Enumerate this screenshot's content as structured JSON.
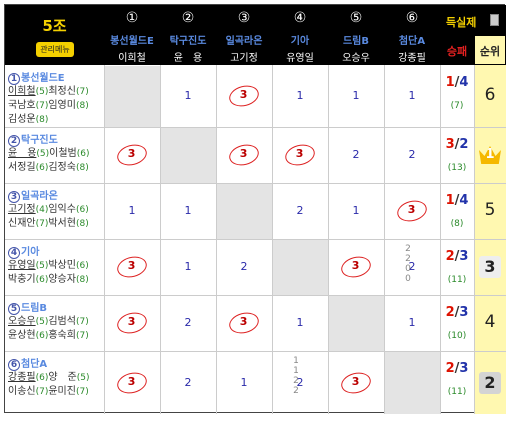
{
  "header": {
    "group_title": "5조",
    "admin_button": "관리메뉴",
    "scorer_label": "득실제",
    "win_loss_label": "승패",
    "rank_label": "순위"
  },
  "teams": [
    {
      "num": "①",
      "name": "봉선월드E",
      "captain": "이희철",
      "name_color": "#5a8ae0"
    },
    {
      "num": "②",
      "name": "탁구진도",
      "captain": "윤　용",
      "name_color": "#5a8ae0"
    },
    {
      "num": "③",
      "name": "일곡라온",
      "captain": "고기정",
      "name_color": "#5a8ae0"
    },
    {
      "num": "④",
      "name": "기아",
      "captain": "유영일",
      "name_color": "#5a8ae0"
    },
    {
      "num": "⑤",
      "name": "드림B",
      "captain": "오승우",
      "name_color": "#5a8ae0"
    },
    {
      "num": "⑥",
      "name": "첨단A",
      "captain": "강종필",
      "name_color": "#5a8ae0"
    }
  ],
  "rows": [
    {
      "num": "①",
      "name": "봉선월드E",
      "members": [
        [
          "이희철",
          "(5)"
        ],
        [
          "최정신",
          "(7)"
        ],
        [
          "국남호",
          "(7)"
        ],
        [
          "임영미",
          "(8)"
        ],
        [
          "김성운",
          "(8)"
        ]
      ],
      "cells": [
        null,
        "1",
        "3",
        "1",
        "1",
        "1"
      ],
      "wins": "1",
      "losses": "4",
      "score": "(7)",
      "rank": "6"
    },
    {
      "num": "②",
      "name": "탁구진도",
      "members": [
        [
          "윤　용",
          "(5)"
        ],
        [
          "이철범",
          "(6)"
        ],
        [
          "서정길",
          "(6)"
        ],
        [
          "김정숙",
          "(8)"
        ]
      ],
      "cells": [
        "3",
        null,
        "3",
        "3",
        "2",
        "2"
      ],
      "wins": "3",
      "losses": "2",
      "score": "(13)",
      "rank": "1"
    },
    {
      "num": "③",
      "name": "일곡라온",
      "members": [
        [
          "고기정",
          "(4)"
        ],
        [
          "임익수",
          "(6)"
        ],
        [
          "신재안",
          "(7)"
        ],
        [
          "박서현",
          "(8)"
        ]
      ],
      "cells": [
        "1",
        "1",
        null,
        "2",
        "1",
        "3"
      ],
      "wins": "1",
      "losses": "4",
      "score": "(8)",
      "rank": "5"
    },
    {
      "num": "④",
      "name": "기아",
      "members": [
        [
          "유영일",
          "(5)"
        ],
        [
          "박상민",
          "(6)"
        ],
        [
          "박충기",
          "(6)"
        ],
        [
          "양승자",
          "(8)"
        ]
      ],
      "cells": [
        "3",
        "1",
        "2",
        null,
        "3",
        "2"
      ],
      "wins": "2",
      "losses": "3",
      "score": "(11)",
      "rank": "3",
      "stack": [
        "2",
        "2",
        "0",
        "0"
      ]
    },
    {
      "num": "⑤",
      "name": "드림B",
      "members": [
        [
          "오승우",
          "(5)"
        ],
        [
          "김범석",
          "(7)"
        ],
        [
          "윤상현",
          "(6)"
        ],
        [
          "홍숙희",
          "(7)"
        ]
      ],
      "cells": [
        "3",
        "2",
        "3",
        "1",
        null,
        "1"
      ],
      "wins": "2",
      "losses": "3",
      "score": "(10)",
      "rank": "4"
    },
    {
      "num": "⑥",
      "name": "첨단A",
      "members": [
        [
          "강종필",
          "(6)"
        ],
        [
          "양　준",
          "(5)"
        ],
        [
          "이송신",
          "(7)"
        ],
        [
          "윤미진",
          "(7)"
        ]
      ],
      "cells": [
        "3",
        "2",
        "1",
        "2",
        "3",
        null
      ],
      "wins": "2",
      "losses": "3",
      "score": "(11)",
      "rank": "2",
      "stack": [
        "1",
        "1",
        "2",
        "2"
      ]
    }
  ],
  "colors": {
    "header_bg": "#000000",
    "team_name": "#5a8ae0",
    "win": "#dd1100",
    "loss": "#2233aa",
    "rank_bg": "#fff8b0",
    "circle": "#dd2222",
    "diag": "#e4e4e4"
  }
}
